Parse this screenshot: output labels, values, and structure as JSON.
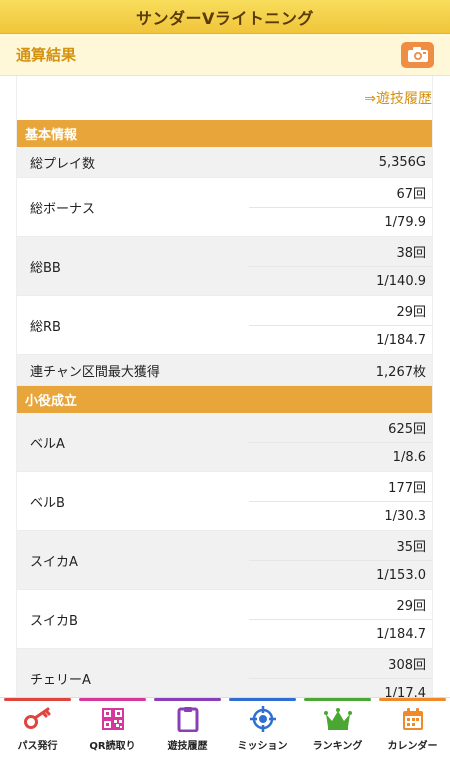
{
  "header": {
    "title": "サンダーVライトニング"
  },
  "section": {
    "title": "通算結果",
    "camera_icon": "camera-icon",
    "accent": "#ef8e43"
  },
  "history_link": "⇒遊技履歴",
  "basic_info": {
    "title": "基本情報",
    "total_play": {
      "label": "総プレイ数",
      "value": "5,356G"
    },
    "total_bonus": {
      "label": "総ボーナス",
      "count": "67回",
      "rate": "1/79.9"
    },
    "total_bb": {
      "label": "総BB",
      "count": "38回",
      "rate": "1/140.9"
    },
    "total_rb": {
      "label": "総RB",
      "count": "29回",
      "rate": "1/184.7"
    },
    "max_chain": {
      "label": "連チャン区間最大獲得",
      "value": "1,267枚"
    }
  },
  "small_roles": {
    "title": "小役成立",
    "bell_a": {
      "label": "ベルA",
      "count": "625回",
      "rate": "1/8.6"
    },
    "bell_b": {
      "label": "ベルB",
      "count": "177回",
      "rate": "1/30.3"
    },
    "suika_a": {
      "label": "スイカA",
      "count": "35回",
      "rate": "1/153.0"
    },
    "suika_b": {
      "label": "スイカB",
      "count": "29回",
      "rate": "1/184.7"
    },
    "cherry_a": {
      "label": "チェリーA",
      "count": "308回",
      "rate": "1/17.4"
    }
  },
  "tabs": [
    {
      "label": "パス発行",
      "icon": "key-icon",
      "color": "#e0443c"
    },
    {
      "label": "QR読取り",
      "icon": "qr-code-icon",
      "color": "#d6379c"
    },
    {
      "label": "遊技履歴",
      "icon": "clipboard-icon",
      "color": "#8a3fb8"
    },
    {
      "label": "ミッション",
      "icon": "target-icon",
      "color": "#2f6fd1"
    },
    {
      "label": "ランキング",
      "icon": "crown-icon",
      "color": "#4aa832"
    },
    {
      "label": "カレンダー",
      "icon": "calendar-icon",
      "color": "#ef8a2a"
    }
  ]
}
